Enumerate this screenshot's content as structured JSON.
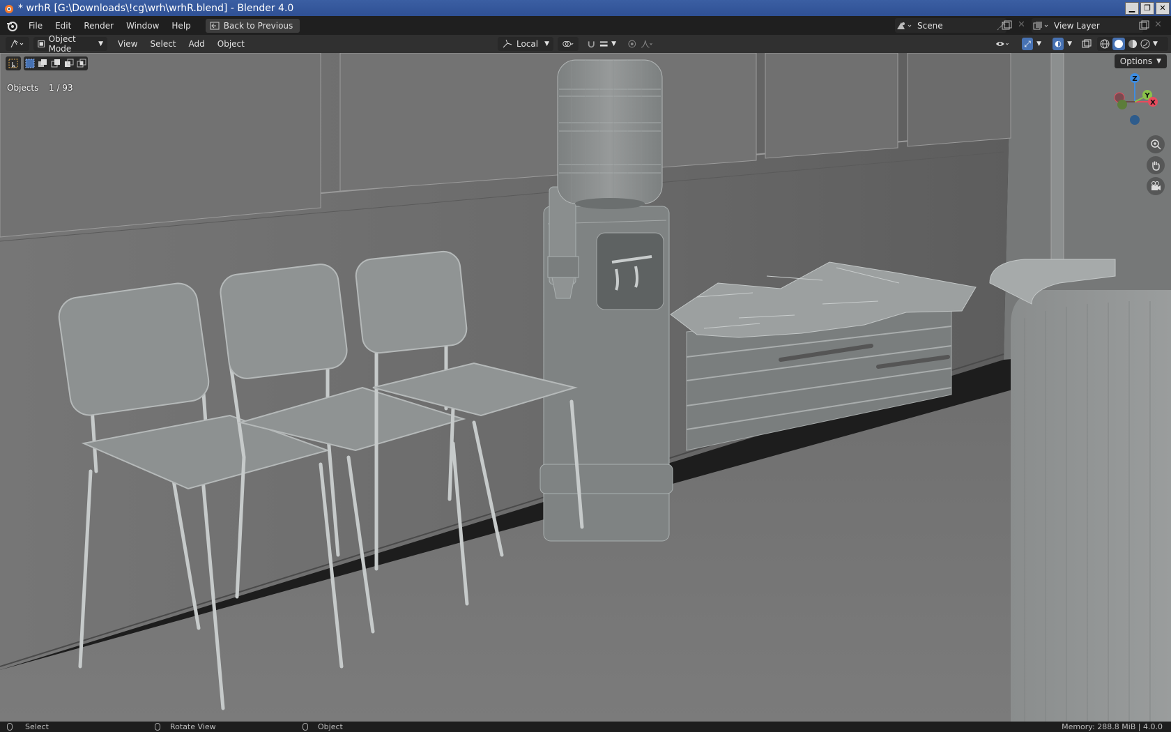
{
  "window": {
    "title": "* wrhR [G:\\Downloads\\!cg\\wrh\\wrhR.blend] - Blender 4.0",
    "controls": [
      "minimize",
      "restore",
      "close"
    ]
  },
  "menubar": {
    "items": [
      "File",
      "Edit",
      "Render",
      "Window",
      "Help"
    ],
    "back_button": "Back to Previous",
    "scene": "Scene",
    "view_layer": "View Layer"
  },
  "header": {
    "mode": "Object Mode",
    "menus": [
      "View",
      "Select",
      "Add",
      "Object"
    ],
    "transform_orientation": "Local"
  },
  "viewport": {
    "objects_label": "Objects",
    "objects_count": "1 / 93",
    "options_label": "Options",
    "gizmo_axes": [
      "Z",
      "Y",
      "X"
    ],
    "axis_colors": {
      "x": "#e84b5d",
      "y": "#8ac24a",
      "z": "#3f8de0"
    }
  },
  "statusbar": {
    "select": "Select",
    "rotate": "Rotate View",
    "object": "Object",
    "memory": "Memory: 288.8 MiB | 4.0.0"
  }
}
